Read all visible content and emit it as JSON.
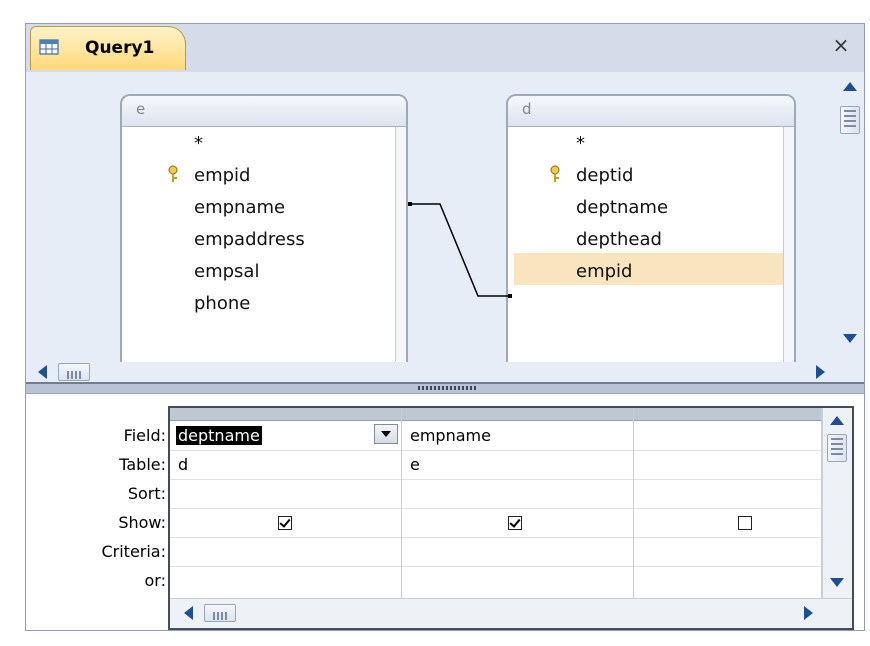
{
  "window": {
    "tab_title": "Query1",
    "close_glyph": "×",
    "tab_icon": "query-icon"
  },
  "tables": [
    {
      "name": "e",
      "fields": [
        {
          "label": "*",
          "primary_key": false
        },
        {
          "label": "empid",
          "primary_key": true
        },
        {
          "label": "empname",
          "primary_key": false
        },
        {
          "label": "empaddress",
          "primary_key": false
        },
        {
          "label": "empsal",
          "primary_key": false
        },
        {
          "label": "phone",
          "primary_key": false
        }
      ]
    },
    {
      "name": "d",
      "fields": [
        {
          "label": "*",
          "primary_key": false
        },
        {
          "label": "deptid",
          "primary_key": true
        },
        {
          "label": "deptname",
          "primary_key": false
        },
        {
          "label": "depthead",
          "primary_key": false
        },
        {
          "label": "empid",
          "primary_key": false,
          "highlighted": true
        }
      ]
    }
  ],
  "relationship": {
    "from": "e.empid",
    "to": "d.empid"
  },
  "grid": {
    "row_labels": [
      "Field:",
      "Table:",
      "Sort:",
      "Show:",
      "Criteria:",
      "or:"
    ],
    "columns": [
      {
        "field": "deptname",
        "table": "d",
        "sort": "",
        "show": true,
        "criteria": "",
        "or": "",
        "selected": true
      },
      {
        "field": "empname",
        "table": "e",
        "sort": "",
        "show": true,
        "criteria": "",
        "or": ""
      },
      {
        "field": "",
        "table": "",
        "sort": "",
        "show": false,
        "criteria": "",
        "or": ""
      }
    ]
  },
  "colors": {
    "tab_gradient_top": "#fff2c8",
    "tab_gradient_bottom": "#ffd97a",
    "highlight": "#f8e4bf",
    "scroll_arrow": "#1e4f8f"
  }
}
